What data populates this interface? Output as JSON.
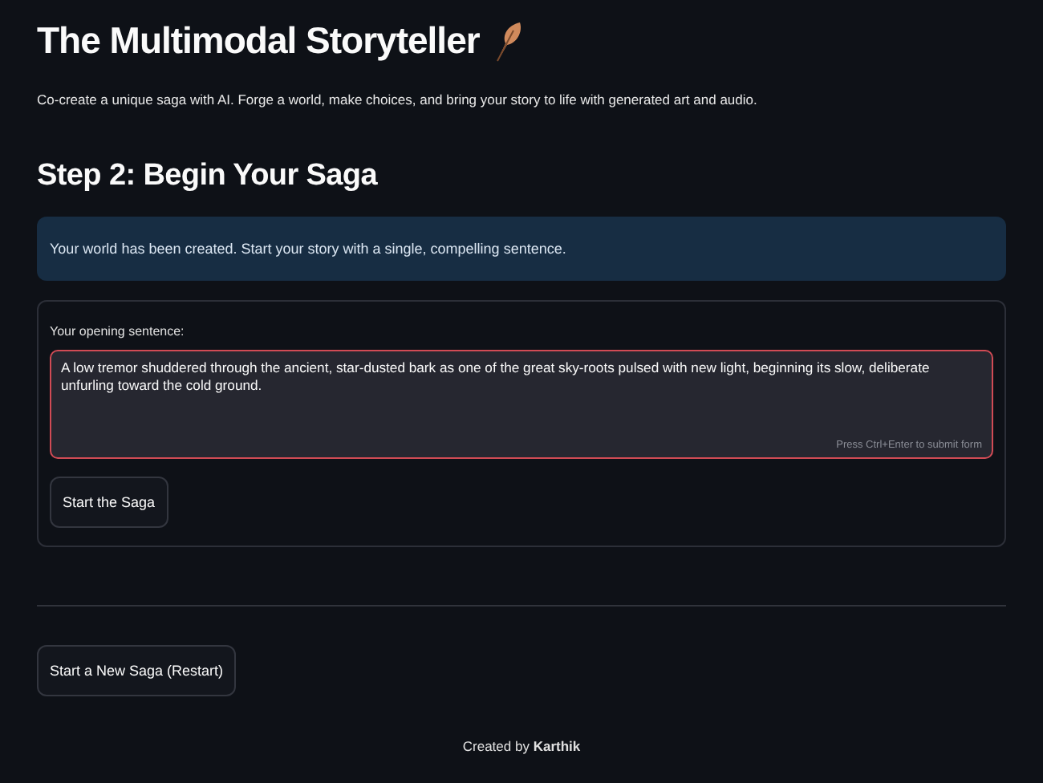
{
  "header": {
    "title": "The Multimodal Storyteller",
    "subtitle": "Co-create a unique saga with AI. Forge a world, make choices, and bring your story to life with generated art and audio."
  },
  "step": {
    "heading": "Step 2: Begin Your Saga",
    "info": "Your world has been created. Start your story with a single, compelling sentence."
  },
  "form": {
    "label": "Your opening sentence:",
    "value": "A low tremor shuddered through the ancient, star-dusted bark as one of the great sky-roots pulsed with new light, beginning its slow, deliberate unfurling toward the cold ground.",
    "hint": "Press Ctrl+Enter to submit form",
    "focused": true,
    "submit": "Start the Saga"
  },
  "restart": "Start a New Saga (Restart)",
  "footer": "Created by **Karthik**"
}
